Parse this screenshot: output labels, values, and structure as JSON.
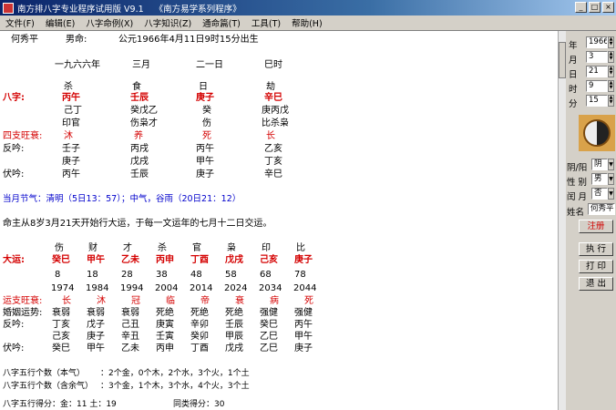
{
  "window": {
    "title_left": "南方排八字专业程序试用版 V9.1",
    "title_right": "《南方易学系列程序》"
  },
  "menu": [
    "文件(F)",
    "编辑(E)",
    "八字命例(X)",
    "八字知识(Z)",
    "通命篇(T)",
    "工具(T)",
    "帮助(H)"
  ],
  "header": {
    "name": "何秀平",
    "gender": "男命:",
    "birth": "公元1966年4月11日9时15分出生"
  },
  "pillars": {
    "lunar": [
      "一九六六年",
      "三月",
      "二一日",
      "巳时"
    ],
    "gods": [
      "杀",
      "食",
      "日",
      "劫"
    ],
    "bazi_label": "八字:",
    "bazi": [
      "丙午",
      "壬辰",
      "庚子",
      "辛巳"
    ],
    "hidden": [
      "己丁",
      "癸戊乙",
      "癸",
      "庚丙戊"
    ],
    "hidden_gods": [
      "印官",
      "伤枭才",
      "伤",
      "比杀枭"
    ],
    "wangshuai_label": "四支旺衰:",
    "wangshuai": [
      "沐",
      "养",
      "死",
      "长"
    ],
    "fanyin_label": "反吟:",
    "fanyin": [
      "壬子",
      "丙戌",
      "丙午",
      "乙亥"
    ],
    "fanyin2": [
      "庚子",
      "戊戌",
      "甲午",
      "丁亥"
    ],
    "fuyin_label": "伏吟:",
    "fuyin": [
      "丙午",
      "壬辰",
      "庚子",
      "辛巳"
    ]
  },
  "jieqi": "当月节气：清明（5日13：57）；中气，谷雨（20日21：12）",
  "dayun_desc": "命主从8岁3月21天开始行大运，于每一文运年的七月十二日交运。",
  "dayun": {
    "gods": [
      "伤",
      "财",
      "才",
      "杀",
      "官",
      "枭",
      "印",
      "比"
    ],
    "label": "大运:",
    "ganzhi": [
      "癸巳",
      "甲午",
      "乙未",
      "丙申",
      "丁酉",
      "戊戌",
      "己亥",
      "庚子"
    ],
    "ages": [
      "8",
      "18",
      "28",
      "38",
      "48",
      "58",
      "68",
      "78"
    ],
    "years": [
      "1974",
      "1984",
      "1994",
      "2004",
      "2014",
      "2024",
      "2034",
      "2044"
    ],
    "wangshuai_label": "运支旺衰:",
    "wangshuai": [
      "长",
      "沐",
      "冠",
      "临",
      "帝",
      "衰",
      "病",
      "死"
    ],
    "hunyin_label": "婚姻运势:",
    "hunyin": [
      "衰弱",
      "衰弱",
      "衰弱",
      "死绝",
      "死绝",
      "死绝",
      "强健",
      "强健"
    ],
    "fanyin_label": "反吟:",
    "fanyin": [
      "丁亥",
      "戊子",
      "己丑",
      "庚寅",
      "辛卯",
      "壬辰",
      "癸巳",
      "丙午"
    ],
    "fanyin2": [
      "己亥",
      "庚子",
      "辛丑",
      "壬寅",
      "癸卯",
      "甲辰",
      "乙巳",
      "甲午"
    ],
    "fuyin_label": "伏吟:",
    "fuyin": [
      "癸巳",
      "甲午",
      "乙未",
      "丙申",
      "丁酉",
      "戊戌",
      "乙巳",
      "庚子"
    ]
  },
  "wuxing1_label": "八字五行个数（本气）",
  "wuxing1": "：2个金，0个木，2个水，3个火，1个土",
  "wuxing2_label": "八字五行个数（含余气）",
  "wuxing2": "：3个金，1个木，3个水，4个火，3个土",
  "score_label": "八字五行得分：金：11   土：19",
  "score_right": "同类得分：30",
  "panel": {
    "year_label": "年",
    "year": "1966",
    "month_label": "月",
    "month": "3",
    "day_label": "日",
    "day": "21",
    "hour_label": "时",
    "hour": "9",
    "minute_label": "分",
    "minute": "15",
    "yinyang_label": "阴/阳",
    "yinyang": "阴",
    "gender_label": "性 别",
    "gender": "男",
    "leap_label": "闰 月",
    "leap": "否",
    "name_label": "姓名",
    "name": "何秀平",
    "register": "注册",
    "run": "执 行",
    "print": "打 印",
    "exit": "退 出"
  }
}
